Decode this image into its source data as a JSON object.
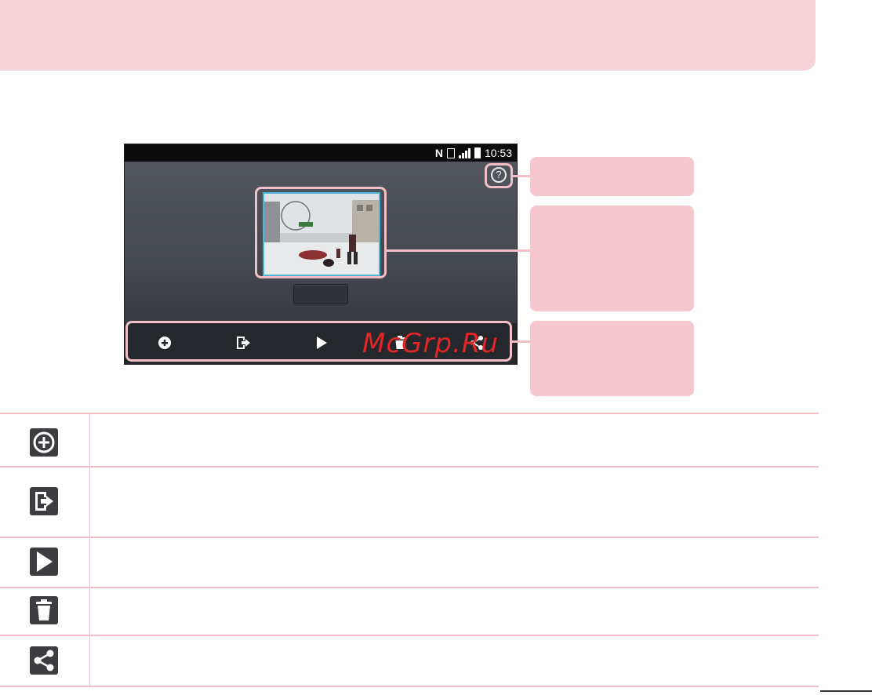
{
  "phone": {
    "status_bar": {
      "nfc_label": "N",
      "time": "10:53"
    },
    "help_glyph": "?"
  },
  "toolbar": {
    "icons": [
      "add-icon",
      "export-icon",
      "play-icon",
      "trash-icon",
      "share-icon"
    ]
  },
  "watermark": "McGrp.Ru",
  "icon_table": {
    "rows": [
      {
        "icon": "add-icon"
      },
      {
        "icon": "export-icon"
      },
      {
        "icon": "play-icon"
      },
      {
        "icon": "trash-icon"
      },
      {
        "icon": "share-icon"
      }
    ]
  },
  "colors": {
    "accent_pink": "#f5c7cf",
    "highlight_pink": "#f0bfc8",
    "thumbnail_border": "#4ab6d8",
    "watermark_red": "#e02626"
  }
}
